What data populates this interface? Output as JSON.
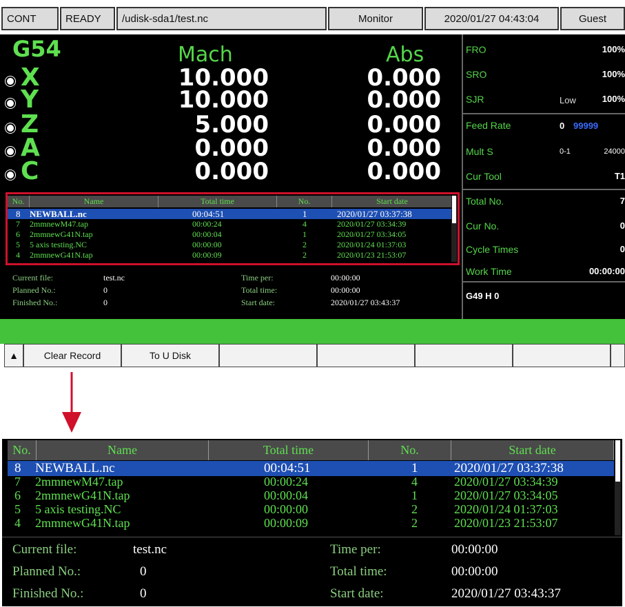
{
  "status": {
    "mode": "CONT",
    "state": "READY",
    "path": "/udisk-sda1/test.nc",
    "screen": "Monitor",
    "datetime": "2020/01/27 04:43:04",
    "user": "Guest"
  },
  "coords": {
    "wcs": "G54",
    "mach_label": "Mach",
    "abs_label": "Abs",
    "axes": [
      {
        "name": "X",
        "mach": "10.000",
        "abs": "0.000"
      },
      {
        "name": "Y",
        "mach": "10.000",
        "abs": "0.000"
      },
      {
        "name": "Z",
        "mach": "5.000",
        "abs": "0.000"
      },
      {
        "name": "A",
        "mach": "0.000",
        "abs": "0.000"
      },
      {
        "name": "C",
        "mach": "0.000",
        "abs": "0.000"
      }
    ]
  },
  "right_panel": {
    "fro_label": "FRO",
    "fro": "100%",
    "sro_label": "SRO",
    "sro": "100%",
    "sjr_label": "SJR",
    "sjr_mode": "Low",
    "sjr": "100%",
    "feed_label": "Feed Rate",
    "feed": "0",
    "feed_max": "99999",
    "mults_label": "Mult S",
    "mults_range": "0-1",
    "mults": "24000",
    "tool_label": "Cur Tool",
    "tool": "T1",
    "total_label": "Total No.",
    "total": "7",
    "curno_label": "Cur No.",
    "curno": "0",
    "cycle_label": "Cycle Times",
    "cycle": "0",
    "work_label": "Work Time",
    "work": "00:00:00",
    "gcode": "G49 H 0"
  },
  "table": {
    "headers": [
      "No.",
      "Name",
      "Total time",
      "No.",
      "Start date"
    ],
    "rows": [
      {
        "no": "8",
        "name": "NEWBALL.nc",
        "time": "00:04:51",
        "count": "1",
        "date": "2020/01/27 03:37:38"
      },
      {
        "no": "7",
        "name": "2mmnewM47.tap",
        "time": "00:00:24",
        "count": "4",
        "date": "2020/01/27 03:34:39"
      },
      {
        "no": "6",
        "name": "2mmnewG41N.tap",
        "time": "00:00:04",
        "count": "1",
        "date": "2020/01/27 03:34:05"
      },
      {
        "no": "5",
        "name": "5 axis testing.NC",
        "time": "00:00:00",
        "count": "2",
        "date": "2020/01/24 01:37:03"
      },
      {
        "no": "4",
        "name": "2mmnewG41N.tap",
        "time": "00:00:09",
        "count": "2",
        "date": "2020/01/23 21:53:07"
      }
    ]
  },
  "info": {
    "current_file_label": "Current file:",
    "current_file": "test.nc",
    "planned_label": "Planned No.:",
    "planned": "0",
    "finished_label": "Finished No.:",
    "finished": "0",
    "time_per_label": "Time per:",
    "time_per": "00:00:00",
    "total_time_label": "Total time:",
    "total_time": "00:00:00",
    "start_date_label": "Start date:",
    "start_date": "2020/01/27 03:43:37"
  },
  "toolbar": {
    "up_icon": "▲",
    "clear_record": "Clear Record",
    "to_udisk": "To U Disk"
  },
  "colors": {
    "accent_green": "#55d64a",
    "selection_blue": "#1e4fb3",
    "highlight_red": "#d0112b"
  }
}
